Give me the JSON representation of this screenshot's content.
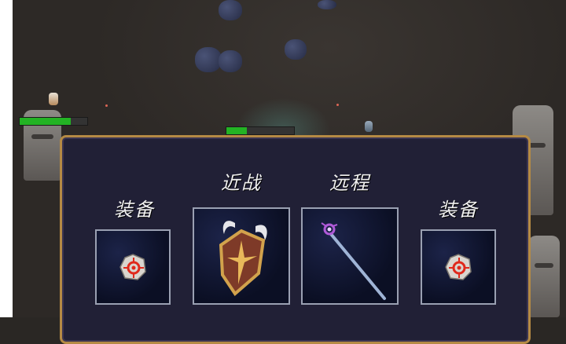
{
  "hud": {
    "enemy_health": 0.75,
    "ally_health": 0.3
  },
  "equip_panel": {
    "left_slot_label": "装备",
    "melee_label": "近战",
    "ranged_label": "远程",
    "right_slot_label": "装备",
    "slots": {
      "left_equip": "rune-stone-icon",
      "melee": "winged-shield-icon",
      "ranged": "magic-staff-icon",
      "right_equip": "rune-stone-icon"
    }
  },
  "colors": {
    "panel_bg": "#212036",
    "panel_border": "#b58a44",
    "health_fill": "#23b324"
  }
}
